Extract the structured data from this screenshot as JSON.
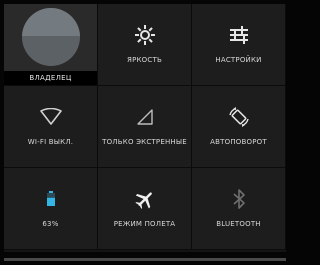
{
  "tiles": {
    "owner": {
      "label": "ВЛАДЕЛЕЦ"
    },
    "brightness": {
      "label": "ЯРКОСТЬ",
      "icon": "brightness-icon"
    },
    "settings": {
      "label": "НАСТРОЙКИ",
      "icon": "settings-sliders-icon"
    },
    "wifi": {
      "label": "WI-FI ВЫКЛ.",
      "icon": "wifi-icon"
    },
    "signal": {
      "label": "ТОЛЬКО ЭКСТРЕННЫЕ",
      "icon": "signal-icon"
    },
    "autorotate": {
      "label": "АВТОПОВОРОТ",
      "icon": "autorotate-icon"
    },
    "battery": {
      "label": "63%",
      "icon": "battery-icon",
      "level": 0.63
    },
    "airplane": {
      "label": "РЕЖИМ ПОЛЕТА",
      "icon": "airplane-icon"
    },
    "bluetooth": {
      "label": "BLUETOOTH",
      "icon": "bluetooth-icon"
    }
  },
  "colors": {
    "background": "#050505",
    "tile": "#1d1d1d",
    "accent_blue": "#33b5e5",
    "text": "#d8d8d8"
  }
}
